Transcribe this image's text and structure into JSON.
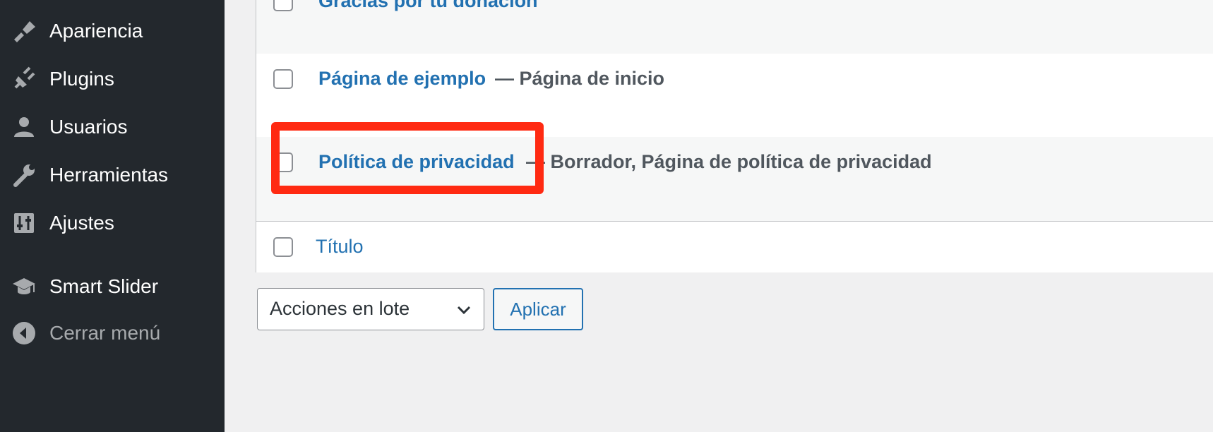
{
  "sidebar": {
    "items": [
      {
        "label": "Apariencia",
        "icon": "paintbrush-icon"
      },
      {
        "label": "Plugins",
        "icon": "plug-icon"
      },
      {
        "label": "Usuarios",
        "icon": "user-icon"
      },
      {
        "label": "Herramientas",
        "icon": "wrench-icon"
      },
      {
        "label": "Ajustes",
        "icon": "sliders-icon"
      },
      {
        "label": "Smart Slider",
        "icon": "graduation-cap-icon"
      }
    ],
    "collapse_label": "Cerrar menú"
  },
  "pages": {
    "rows": [
      {
        "title": "Gracias por tu donación",
        "state": ""
      },
      {
        "title": "Página de ejemplo",
        "state": "— Página de inicio"
      },
      {
        "title": "Política de privacidad",
        "state": "— Borrador, Página de política de privacidad"
      }
    ],
    "footer_column_title": "Título"
  },
  "bulk_actions": {
    "selected": "Acciones en lote",
    "apply_label": "Aplicar"
  },
  "colors": {
    "sidebar_bg": "#23282d",
    "link": "#2271b1",
    "highlight": "#ff2a12"
  }
}
